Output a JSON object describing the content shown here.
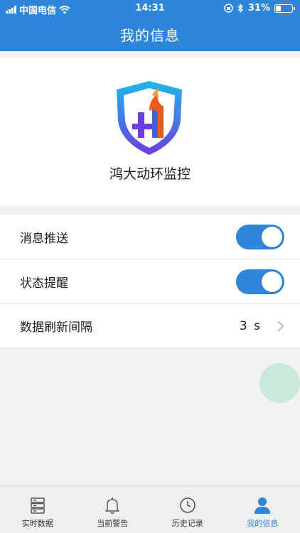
{
  "status_bar": {
    "carrier": "中国电信",
    "time": "14:31",
    "battery": "31%",
    "battery_level": 0.31
  },
  "nav": {
    "title": "我的信息"
  },
  "brand": {
    "app_name": "鸿大动环监控"
  },
  "settings": [
    {
      "label": "消息推送",
      "type": "toggle",
      "on": true
    },
    {
      "label": "状态提醒",
      "type": "toggle",
      "on": true
    },
    {
      "label": "数据刷新间隔",
      "type": "value",
      "value": "3 s"
    }
  ],
  "tabs": [
    {
      "label": "实时数据",
      "icon": "server-icon",
      "active": false
    },
    {
      "label": "当前警告",
      "icon": "bell-icon",
      "active": false
    },
    {
      "label": "历史记录",
      "icon": "clock-icon",
      "active": false
    },
    {
      "label": "我的信息",
      "icon": "user-icon",
      "active": true
    }
  ],
  "colors": {
    "accent": "#2d86d9",
    "logo_gradient": [
      "#1fb8e8",
      "#6a3ee0"
    ],
    "logo_orange": "#f05a1e"
  }
}
